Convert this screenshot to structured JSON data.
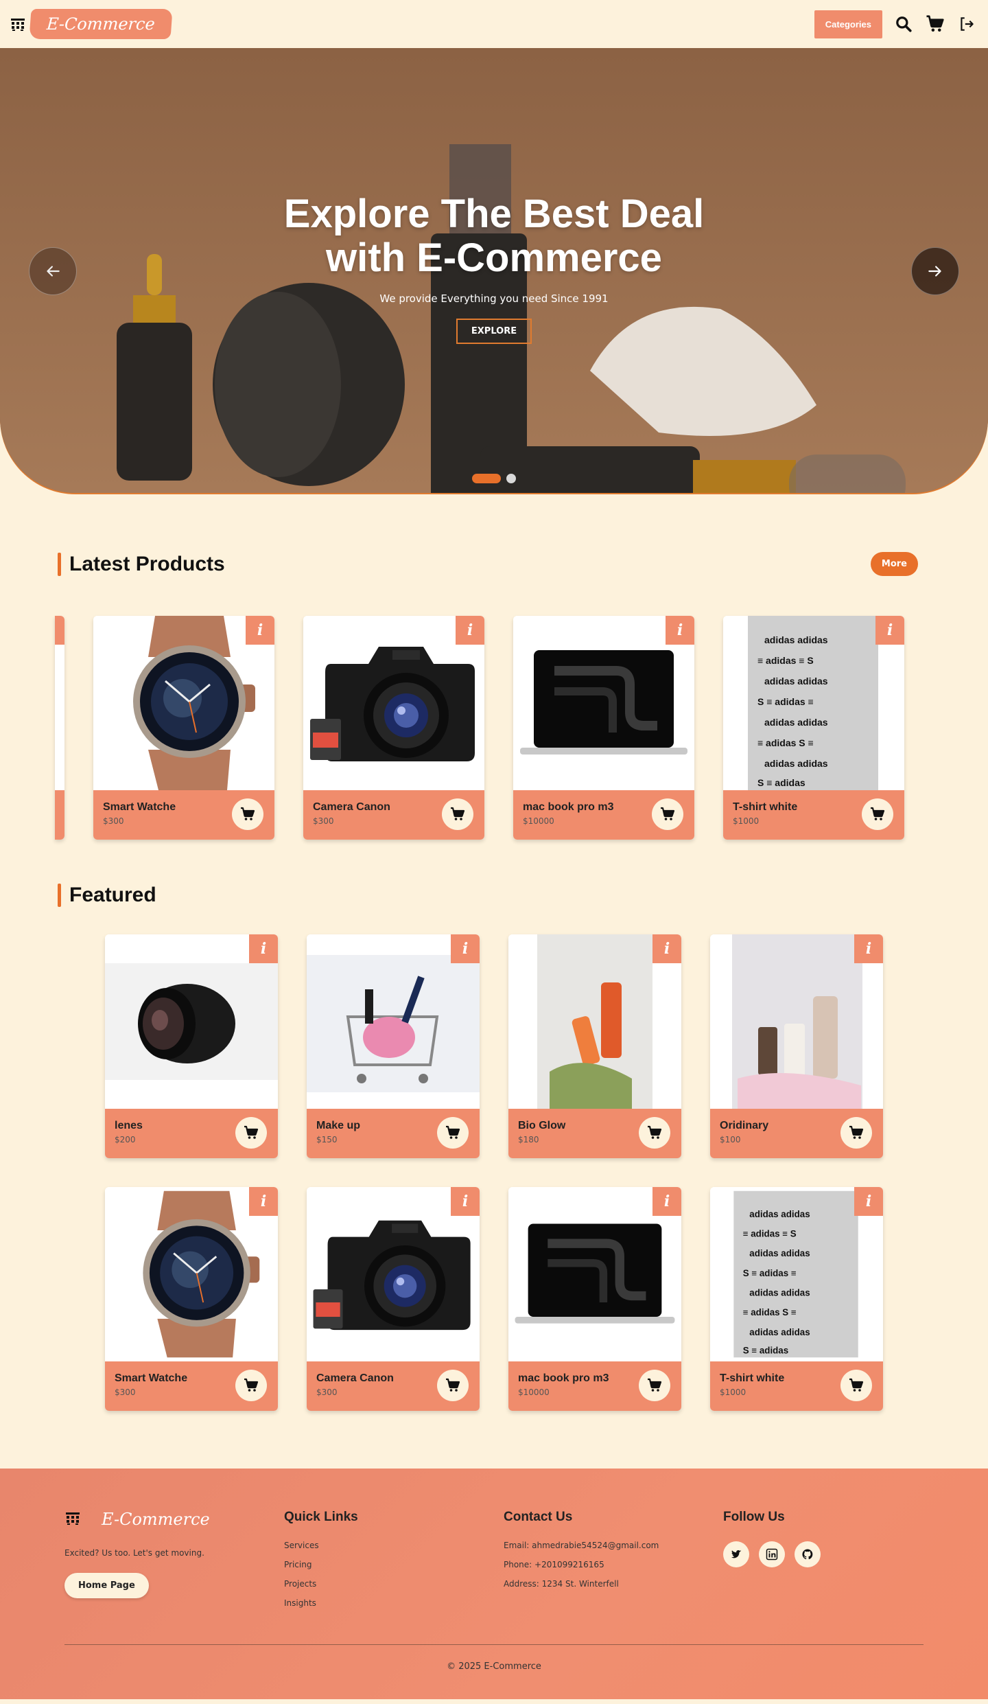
{
  "nav": {
    "brand": "E-Commerce",
    "categories_label": "Categories",
    "icons": [
      "menu-grid-icon",
      "search-icon",
      "cart-icon",
      "logout-icon"
    ]
  },
  "hero": {
    "title": "Explore The Best Deal with E-Commerce",
    "subtitle": "We provide Everything you need Since 1991",
    "button": "EXPLORE",
    "slide_count": 2,
    "active_slide": 1
  },
  "latest": {
    "title": "Latest Products",
    "more_label": "More",
    "products": [
      {
        "name": "Smart Watche",
        "price": "$300",
        "image": "smart-watch"
      },
      {
        "name": "Camera Canon",
        "price": "$300",
        "image": "camera"
      },
      {
        "name": "mac book pro m3",
        "price": "$10000",
        "image": "laptop"
      },
      {
        "name": "T-shirt white",
        "price": "$1000",
        "image": "tshirt"
      }
    ]
  },
  "featured": {
    "title": "Featured",
    "products": [
      {
        "name": "lenes",
        "price": "$200",
        "image": "lens"
      },
      {
        "name": "Make up",
        "price": "$150",
        "image": "makeup"
      },
      {
        "name": "Bio Glow",
        "price": "$180",
        "image": "bioglow"
      },
      {
        "name": "Oridinary",
        "price": "$100",
        "image": "ordinary"
      },
      {
        "name": "Smart Watche",
        "price": "$300",
        "image": "smart-watch"
      },
      {
        "name": "Camera Canon",
        "price": "$300",
        "image": "camera"
      },
      {
        "name": "mac book pro m3",
        "price": "$10000",
        "image": "laptop"
      },
      {
        "name": "T-shirt white",
        "price": "$1000",
        "image": "tshirt"
      }
    ]
  },
  "footer": {
    "brand": "E-Commerce",
    "tagline": "Excited? Us too. Let's get moving.",
    "home_button": "Home Page",
    "quick_links_title": "Quick Links",
    "quick_links": [
      "Services",
      "Pricing",
      "Projects",
      "Insights"
    ],
    "contact_title": "Contact Us",
    "contact": {
      "email": "Email: ahmedrabie54524@gmail.com",
      "phone": "Phone: +201099216165",
      "address": "Address: 1234 St. Winterfell"
    },
    "follow_title": "Follow Us",
    "socials": [
      "twitter-icon",
      "linkedin-icon",
      "github-icon"
    ],
    "copyright": "© 2025 E-Commerce"
  },
  "colors": {
    "background": "#fdf2dc",
    "accent": "#f08c6c",
    "orange": "#e8702a",
    "hero_bg": "#8d6347"
  }
}
